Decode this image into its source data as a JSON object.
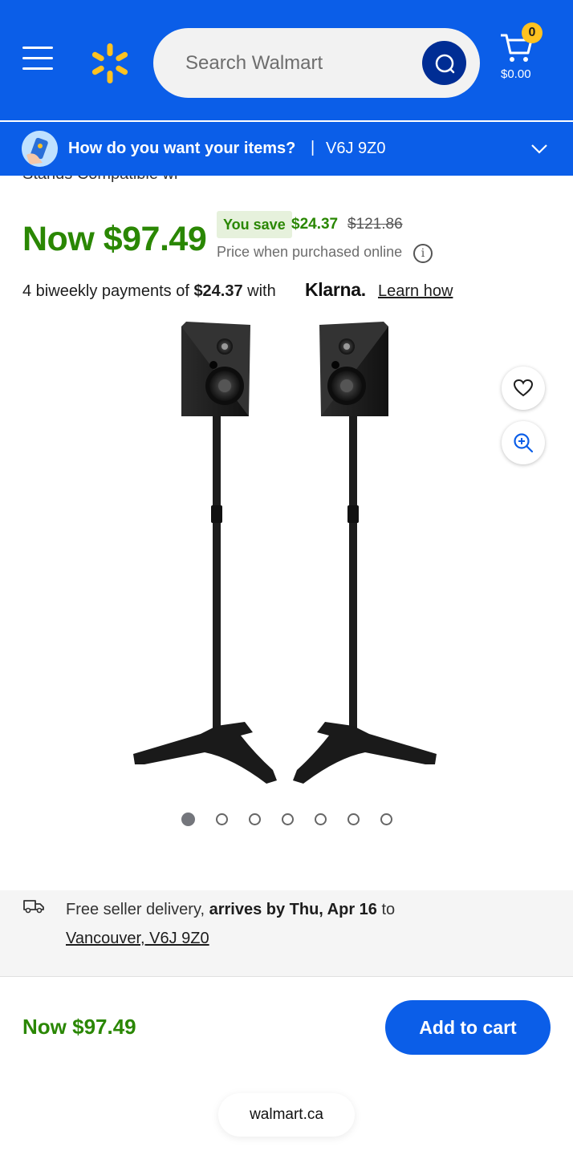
{
  "header": {
    "search_placeholder": "Search Walmart",
    "cart_count": "0",
    "cart_total": "$0.00",
    "brand_color": "#0b5ee8",
    "spark_color": "#ffc220"
  },
  "delivery_prompt": {
    "question": "How do you want your items?",
    "separator": "|",
    "postal_code": "V6J 9Z0"
  },
  "product": {
    "title_cut": "Stands Compatible wi",
    "now_price": "Now $97.49",
    "you_save_label": "You save",
    "save_amount": "$24.37",
    "was_price": "$121.86",
    "price_note": "Price when purchased online",
    "info_icon": "i",
    "klarna_prefix": "4 biweekly payments of ",
    "klarna_amount": "$24.37",
    "klarna_with": " with",
    "klarna_logo": "Klarna.",
    "learn_how": "Learn how",
    "image_count": 7,
    "active_image": 1
  },
  "shipping": {
    "prefix": "Free seller delivery, ",
    "arrives": "arrives by Thu, Apr 16",
    "to": " to",
    "location": "Vancouver, V6J 9Z0"
  },
  "bottom_bar": {
    "price": "Now $97.49",
    "add_to_cart": "Add to cart"
  },
  "browser": {
    "url": "walmart.ca"
  }
}
